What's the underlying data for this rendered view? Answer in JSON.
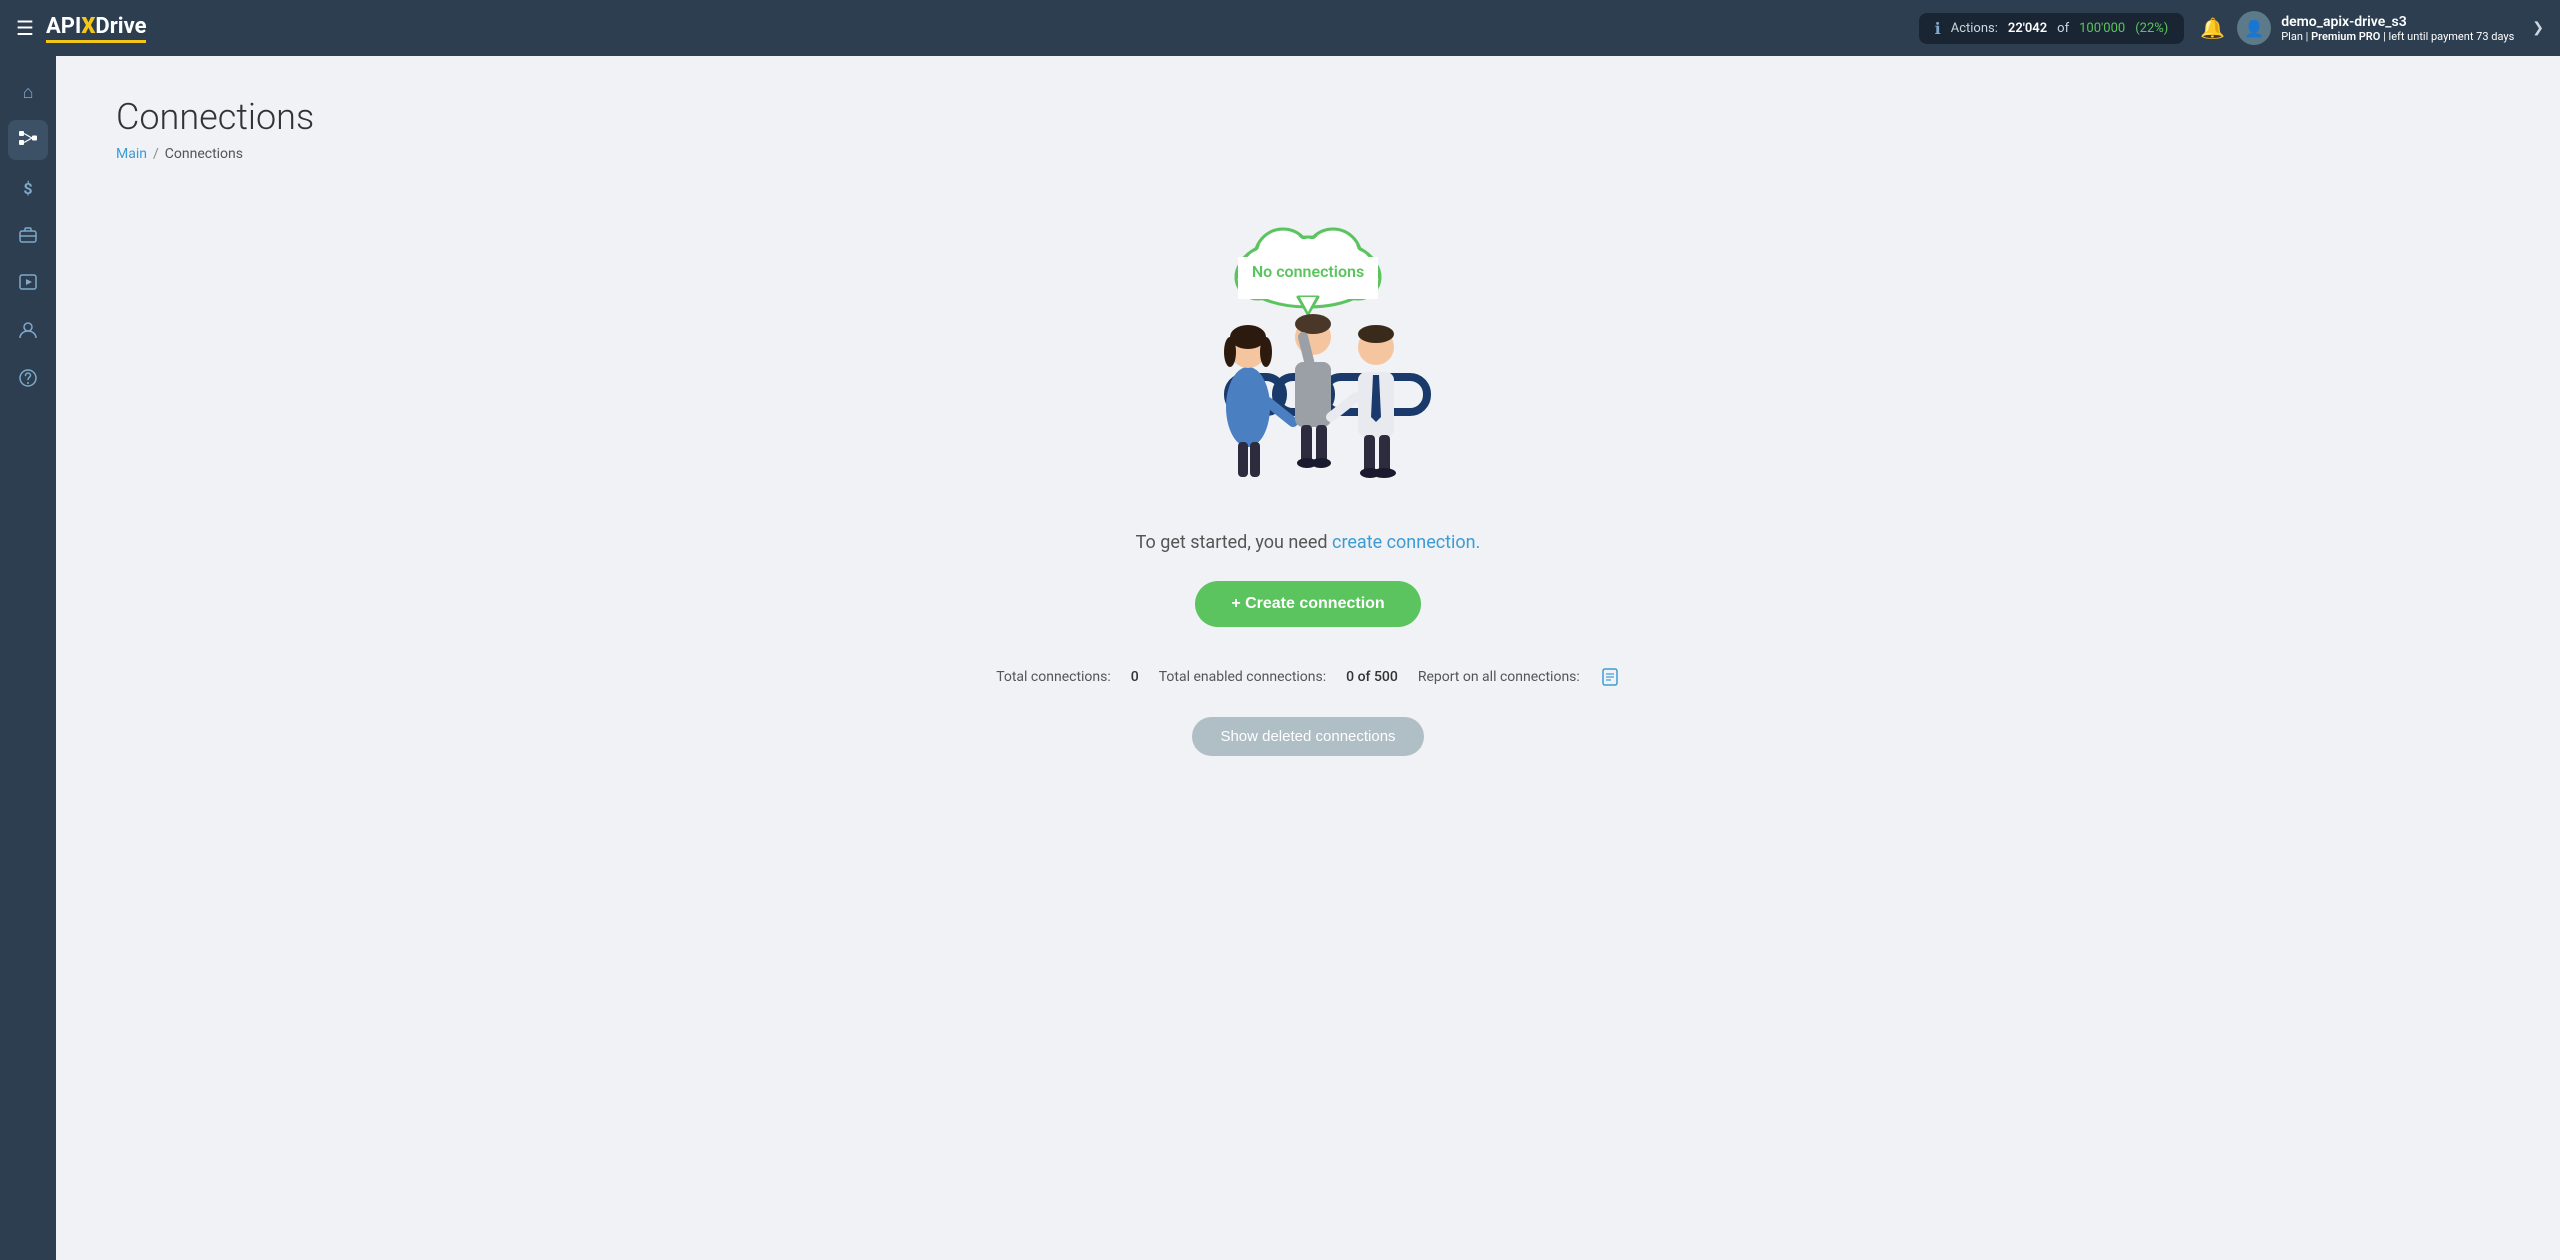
{
  "app": {
    "title": "APIXDrive",
    "logo": {
      "api": "API",
      "x": "X",
      "drive": "Drive"
    }
  },
  "header": {
    "hamburger_label": "☰",
    "actions": {
      "label": "Actions:",
      "current": "22'042",
      "of_text": "of",
      "total": "100'000",
      "percent": "(22%)"
    },
    "bell_icon": "🔔",
    "user": {
      "name": "demo_apix-drive_s3",
      "plan_label": "Plan |",
      "plan_name": "Premium PRO",
      "plan_suffix": "| left until payment",
      "days": "73 days",
      "avatar_icon": "👤"
    },
    "chevron": "❯"
  },
  "sidebar": {
    "items": [
      {
        "icon": "⌂",
        "name": "home",
        "active": false
      },
      {
        "icon": "⋮⋮",
        "name": "connections",
        "active": true
      },
      {
        "icon": "$",
        "name": "billing",
        "active": false
      },
      {
        "icon": "💼",
        "name": "services",
        "active": false
      },
      {
        "icon": "▶",
        "name": "tutorials",
        "active": false
      },
      {
        "icon": "👤",
        "name": "profile",
        "active": false
      },
      {
        "icon": "?",
        "name": "help",
        "active": false
      }
    ]
  },
  "page": {
    "title": "Connections",
    "breadcrumb": {
      "main_link": "Main",
      "separator": "/",
      "current": "Connections"
    }
  },
  "illustration": {
    "cloud_text": "No connections"
  },
  "empty_state": {
    "prompt_prefix": "To get started, you need ",
    "prompt_link": "create connection.",
    "create_button": "+ Create connection",
    "stats": {
      "total_label": "Total connections:",
      "total_value": "0",
      "enabled_label": "Total enabled connections:",
      "enabled_value": "0 of 500",
      "report_label": "Report on all connections:"
    },
    "show_deleted_button": "Show deleted connections"
  }
}
